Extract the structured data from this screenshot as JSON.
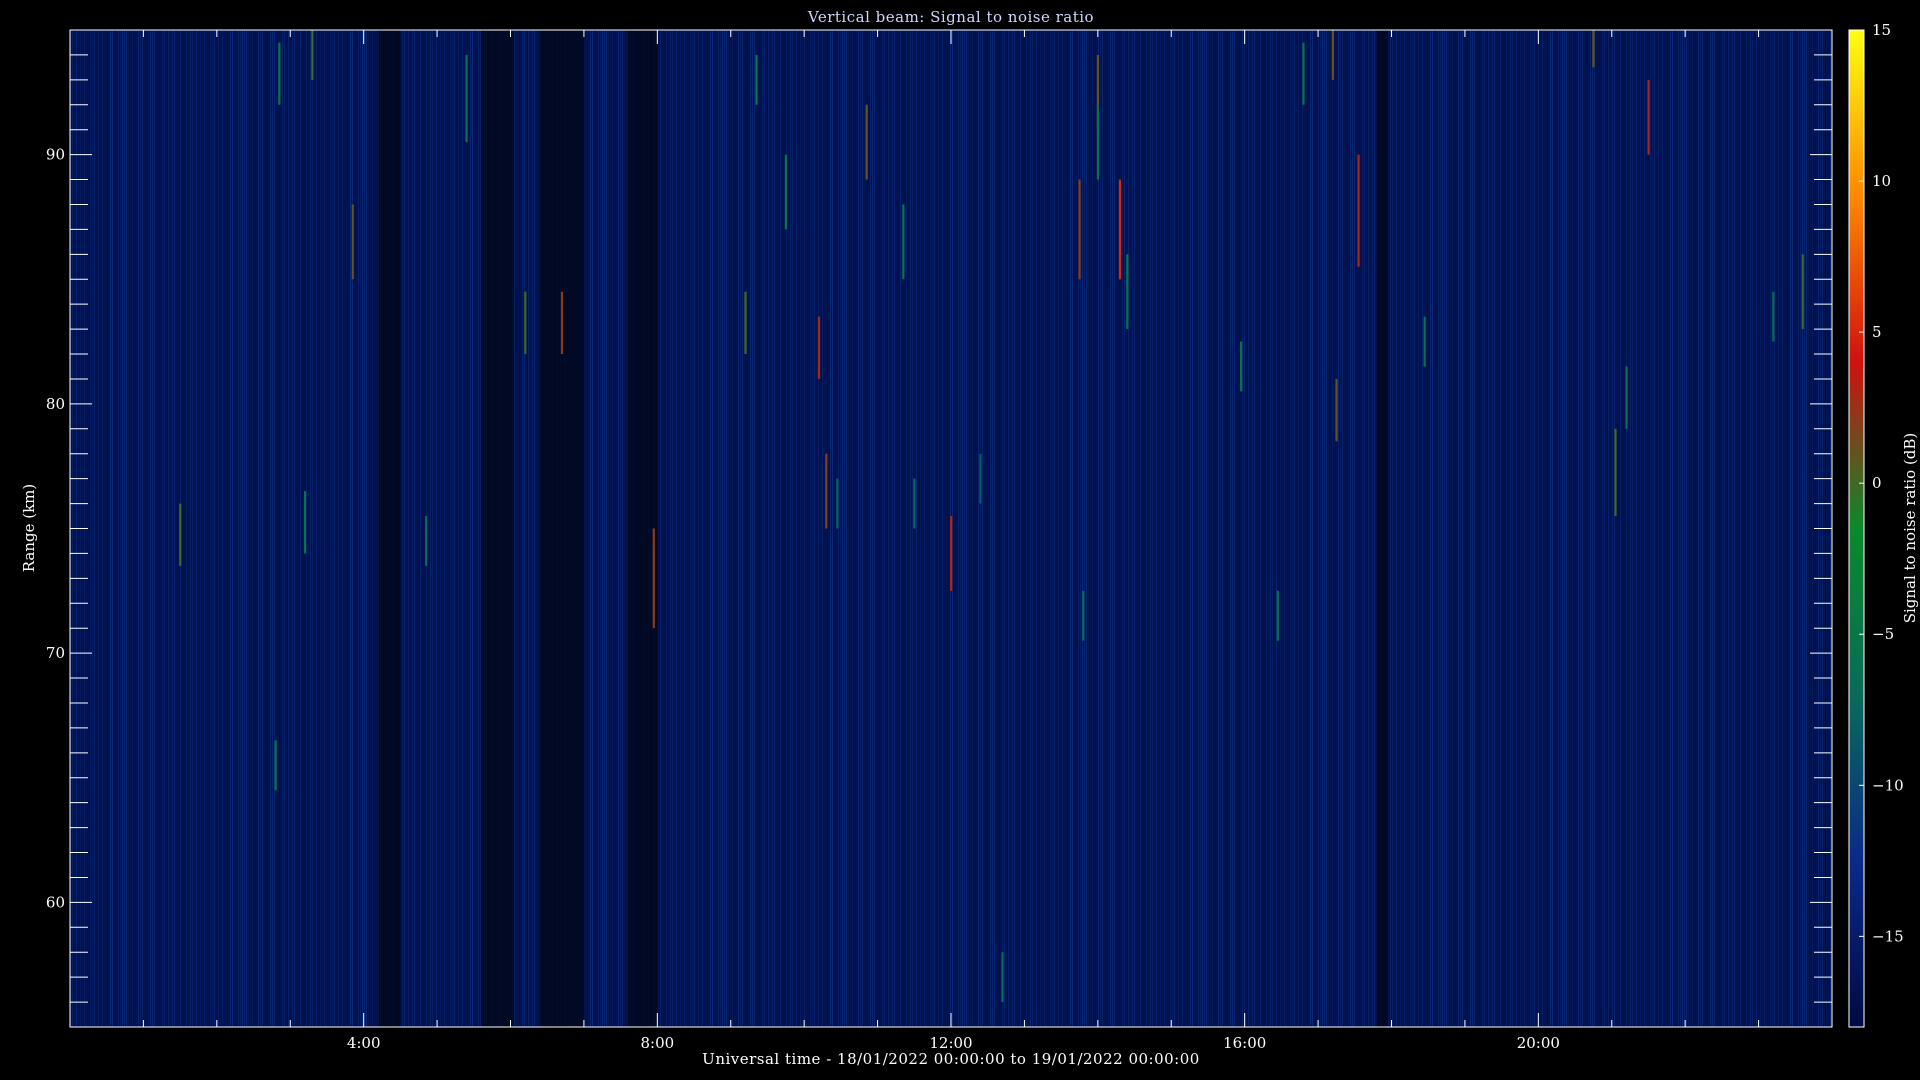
{
  "chart_data": {
    "type": "heatmap",
    "title": "Vertical beam: Signal to noise ratio",
    "xlabel": "Universal time - 18/01/2022 00:00:00 to 19/01/2022 00:00:00",
    "ylabel": "Range (km)",
    "colorbar_label": "Signal to noise ratio (dB)",
    "xlim_hours": [
      0,
      24
    ],
    "ylim_km": [
      55,
      95
    ],
    "x_ticks": [
      {
        "hour": 4,
        "label": "4:00"
      },
      {
        "hour": 8,
        "label": "8:00"
      },
      {
        "hour": 12,
        "label": "12:00"
      },
      {
        "hour": 16,
        "label": "16:00"
      },
      {
        "hour": 20,
        "label": "20:00"
      }
    ],
    "y_ticks": [
      {
        "km": 60,
        "label": "60"
      },
      {
        "km": 70,
        "label": "70"
      },
      {
        "km": 80,
        "label": "80"
      },
      {
        "km": 90,
        "label": "90"
      }
    ],
    "colorbar": {
      "range_db": [
        -18,
        15
      ],
      "ticks": [
        15,
        10,
        5,
        0,
        -5,
        -10,
        -15
      ],
      "colors": [
        "#000a44",
        "#0a2a88",
        "#0a6a5a",
        "#0a8a2a",
        "#d01010",
        "#ff8800",
        "#ffff10"
      ]
    },
    "background_level_db": -17,
    "low_signal_bands_hours": [
      [
        4.2,
        4.5
      ],
      [
        5.6,
        6.05
      ],
      [
        6.4,
        7.0
      ],
      [
        7.6,
        8.0
      ],
      [
        17.8,
        17.95
      ]
    ],
    "notable_echoes": [
      {
        "hour": 3.3,
        "km_from": 93,
        "km_to": 95,
        "snr_db": 0
      },
      {
        "hour": 3.85,
        "km_from": 85,
        "km_to": 88,
        "snr_db": 1
      },
      {
        "hour": 1.5,
        "km_from": 73.5,
        "km_to": 76,
        "snr_db": 0
      },
      {
        "hour": 6.2,
        "km_from": 82,
        "km_to": 84.5,
        "snr_db": 0
      },
      {
        "hour": 6.7,
        "km_from": 82,
        "km_to": 84.5,
        "snr_db": 2
      },
      {
        "hour": 7.95,
        "km_from": 71,
        "km_to": 75,
        "snr_db": 2
      },
      {
        "hour": 9.2,
        "km_from": 82,
        "km_to": 84.5,
        "snr_db": 0
      },
      {
        "hour": 10.2,
        "km_from": 81,
        "km_to": 83.5,
        "snr_db": 3
      },
      {
        "hour": 10.3,
        "km_from": 75,
        "km_to": 78,
        "snr_db": 2
      },
      {
        "hour": 10.45,
        "km_from": 75,
        "km_to": 77,
        "snr_db": -8
      },
      {
        "hour": 10.85,
        "km_from": 89,
        "km_to": 92,
        "snr_db": 1
      },
      {
        "hour": 11.5,
        "km_from": 75,
        "km_to": 77,
        "snr_db": -7
      },
      {
        "hour": 12.0,
        "km_from": 72.5,
        "km_to": 75.5,
        "snr_db": 3
      },
      {
        "hour": 12.4,
        "km_from": 76,
        "km_to": 78,
        "snr_db": -8
      },
      {
        "hour": 13.75,
        "km_from": 85,
        "km_to": 89,
        "snr_db": 2
      },
      {
        "hour": 14.0,
        "km_from": 91,
        "km_to": 94,
        "snr_db": 1
      },
      {
        "hour": 14.3,
        "km_from": 85,
        "km_to": 89,
        "snr_db": 5
      },
      {
        "hour": 17.2,
        "km_from": 93,
        "km_to": 95,
        "snr_db": 1
      },
      {
        "hour": 17.55,
        "km_from": 85.5,
        "km_to": 90,
        "snr_db": 3
      },
      {
        "hour": 17.25,
        "km_from": 78.5,
        "km_to": 81,
        "snr_db": 1
      },
      {
        "hour": 20.75,
        "km_from": 93.5,
        "km_to": 95,
        "snr_db": 1
      },
      {
        "hour": 21.05,
        "km_from": 75.5,
        "km_to": 79,
        "snr_db": 0
      },
      {
        "hour": 21.5,
        "km_from": 90,
        "km_to": 93,
        "snr_db": 3
      },
      {
        "hour": 23.6,
        "km_from": 83,
        "km_to": 86,
        "snr_db": 0
      },
      {
        "hour": 2.85,
        "km_from": 92,
        "km_to": 94.5,
        "snr_db": -6
      },
      {
        "hour": 5.4,
        "km_from": 90.5,
        "km_to": 94,
        "snr_db": -6
      },
      {
        "hour": 4.85,
        "km_from": 73.5,
        "km_to": 75.5,
        "snr_db": -7
      },
      {
        "hour": 3.2,
        "km_from": 74,
        "km_to": 76.5,
        "snr_db": -6
      },
      {
        "hour": 2.8,
        "km_from": 64.5,
        "km_to": 66.5,
        "snr_db": -6
      },
      {
        "hour": 9.35,
        "km_from": 92,
        "km_to": 94,
        "snr_db": -5
      },
      {
        "hour": 9.75,
        "km_from": 87,
        "km_to": 90,
        "snr_db": -6
      },
      {
        "hour": 11.35,
        "km_from": 85,
        "km_to": 88,
        "snr_db": -6
      },
      {
        "hour": 14.0,
        "km_from": 89,
        "km_to": 92,
        "snr_db": -6
      },
      {
        "hour": 14.4,
        "km_from": 83,
        "km_to": 86,
        "snr_db": -6
      },
      {
        "hour": 15.95,
        "km_from": 80.5,
        "km_to": 82.5,
        "snr_db": -6
      },
      {
        "hour": 16.45,
        "km_from": 70.5,
        "km_to": 72.5,
        "snr_db": -6
      },
      {
        "hour": 16.8,
        "km_from": 92,
        "km_to": 94.5,
        "snr_db": -6
      },
      {
        "hour": 18.45,
        "km_from": 81.5,
        "km_to": 83.5,
        "snr_db": -6
      },
      {
        "hour": 21.2,
        "km_from": 79,
        "km_to": 81.5,
        "snr_db": -6
      },
      {
        "hour": 12.7,
        "km_from": 56,
        "km_to": 58,
        "snr_db": -7
      },
      {
        "hour": 13.8,
        "km_from": 70.5,
        "km_to": 72.5,
        "snr_db": -7
      },
      {
        "hour": 23.2,
        "km_from": 82.5,
        "km_to": 84.5,
        "snr_db": -7
      }
    ]
  }
}
